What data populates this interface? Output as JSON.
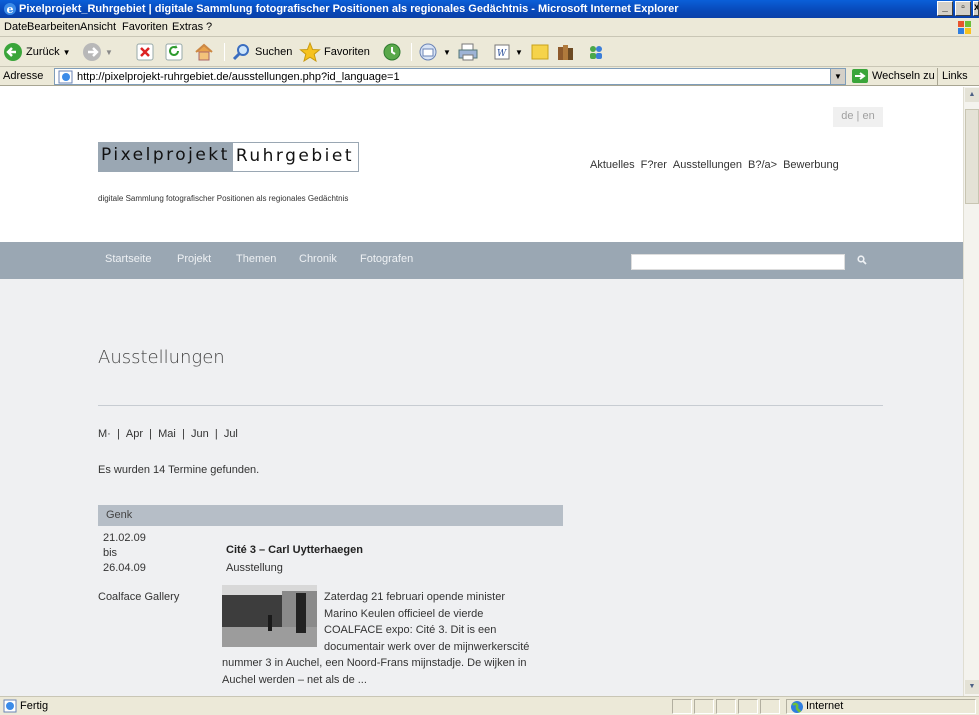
{
  "window": {
    "title": "Pixelprojekt_Ruhrgebiet | digitale Sammlung fotografischer Positionen als regionales Gedächtnis - Microsoft Internet Explorer"
  },
  "menu": [
    "Datei",
    "Bearbeiten",
    "Ansicht",
    "Favoriten",
    "Extras",
    "?"
  ],
  "toolbar": {
    "back_label": "Zurück",
    "search_label": "Suchen",
    "favorites_label": "Favoriten"
  },
  "address": {
    "label": "Adresse",
    "url": "http://pixelprojekt-ruhrgebiet.de/ausstellungen.php?id_language=1",
    "go_label": "Wechseln zu",
    "links_label": "Links"
  },
  "page": {
    "lang_switch": "de | en",
    "logo_part1": "Pixelprojekt",
    "logo_part2": "Ruhrgebiet",
    "tagline": "digitale Sammlung fotografischer Positionen als regionales Gedächtnis",
    "top_nav": [
      "Aktuelles",
      "F?rer",
      "Ausstellungen",
      "B?/a>",
      "Bewerbung"
    ],
    "main_nav": [
      "Startseite",
      "Projekt",
      "Themen",
      "Chronik",
      "Fotografen"
    ],
    "search_placeholder": "",
    "heading": "Ausstellungen",
    "months": [
      "M·",
      "Apr",
      "Mai",
      "Jun",
      "Jul"
    ],
    "found_text": "Es wurden 14 Termine gefunden.",
    "city": "Genk",
    "event": {
      "date_from": "21.02.09",
      "date_sep": "bis",
      "date_to": "26.04.09",
      "title": "Cité 3 – Carl Uytterhaegen",
      "type": "Ausstellung",
      "venue": "Coalface Gallery",
      "description": "Zaterdag 21 februari opende minister Marino Keulen officieel de vierde COALFACE expo: Cité 3. Dit is een documentair werk over de mijnwerkerscité nummer 3 in Auchel, een Noord-Frans mijnstadje. De wijken in Auchel werden – net als de ..."
    }
  },
  "status": {
    "text": "Fertig",
    "zone": "Internet"
  }
}
